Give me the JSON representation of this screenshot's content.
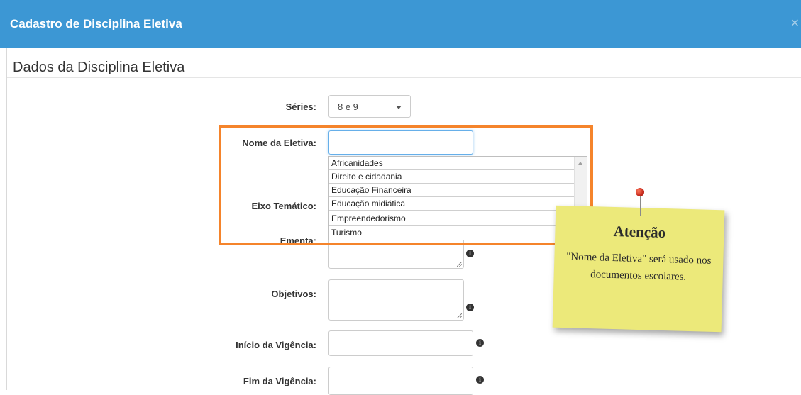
{
  "header": {
    "title": "Cadastro de Disciplina Eletiva",
    "close": "×"
  },
  "section": {
    "title": "Dados da Disciplina Eletiva"
  },
  "form": {
    "series_label": "Séries:",
    "series_value": "8 e 9",
    "nome_label": "Nome da Eletiva:",
    "nome_value": "",
    "eixo_label": "Eixo Temático:",
    "ementa_label": "Ementa:",
    "objetivos_label": "Objetivos:",
    "inicio_label": "Início da Vigência:",
    "fim_label": "Fim da Vigência:",
    "info_glyph": "i"
  },
  "eixo_options": [
    "Africanidades",
    "Direito e cidadania",
    "Educação Financeira",
    "Educação midiática",
    "Empreendedorismo",
    "Turismo"
  ],
  "note": {
    "title": "Atenção",
    "text": "\"Nome da Eletiva\" será usado nos documentos escolares."
  },
  "colors": {
    "header": "#3c97d4",
    "highlight": "#f5842b",
    "note": "#ece97a"
  }
}
